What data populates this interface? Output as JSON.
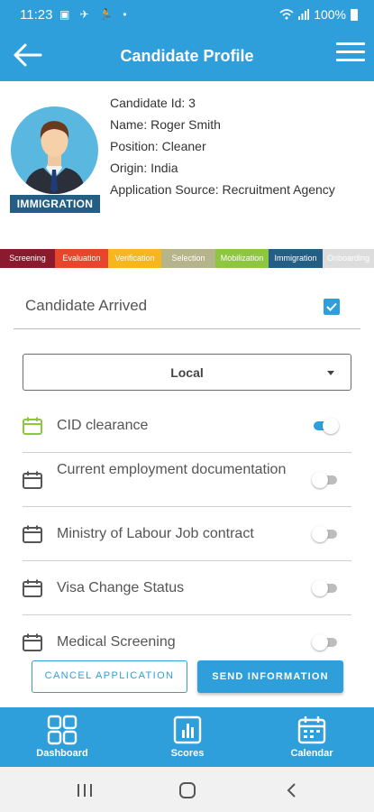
{
  "status_bar": {
    "time": "11:23",
    "left_icons": "▣ ✈ 🏃 •",
    "battery": "100%"
  },
  "header": {
    "title": "Candidate Profile",
    "back_icon": "arrow-left-icon",
    "menu_icon": "hamburger-menu-icon"
  },
  "profile": {
    "candidate_id": "Candidate Id: 3",
    "name": "Name: Roger Smith",
    "position": "Position: Cleaner",
    "origin": "Origin: India",
    "application_source": "Application Source: Recruitment Agency",
    "status_badge": "IMMIGRATION"
  },
  "pipeline": [
    {
      "label": "Screening",
      "color": "#8b1a2f"
    },
    {
      "label": "Evaluation",
      "color": "#e8462c"
    },
    {
      "label": "Verification",
      "color": "#f6b61c"
    },
    {
      "label": "Selection",
      "color": "#b5b48a"
    },
    {
      "label": "Mobilization",
      "color": "#8ec63f"
    },
    {
      "label": "Immigration",
      "color": "#245e85"
    },
    {
      "label": "Onboarding",
      "color": "#dddddd"
    }
  ],
  "arrived": {
    "label": "Candidate Arrived",
    "checked": true
  },
  "dropdown": {
    "value": "Local"
  },
  "checklist": [
    {
      "label": "CID clearance",
      "enabled": true,
      "icon_color": "#8ec63f"
    },
    {
      "label": "Current employment documentation",
      "enabled": false,
      "icon_color": "#555555"
    },
    {
      "label": "Ministry of Labour Job contract",
      "enabled": false,
      "icon_color": "#555555"
    },
    {
      "label": "Visa Change Status",
      "enabled": false,
      "icon_color": "#555555"
    },
    {
      "label": "Medical Screening",
      "enabled": false,
      "icon_color": "#555555"
    }
  ],
  "actions": {
    "cancel": "CANCEL APPLICATION",
    "send": "SEND INFORMATION"
  },
  "bottom_nav": [
    {
      "label": "Dashboard",
      "icon": "grid-icon"
    },
    {
      "label": "Scores",
      "icon": "bar-chart-icon"
    },
    {
      "label": "Calendar",
      "icon": "calendar-icon"
    }
  ],
  "colors": {
    "primary": "#2f9fdc",
    "badge": "#245e85",
    "toggle_on": "#2f9fdc"
  }
}
